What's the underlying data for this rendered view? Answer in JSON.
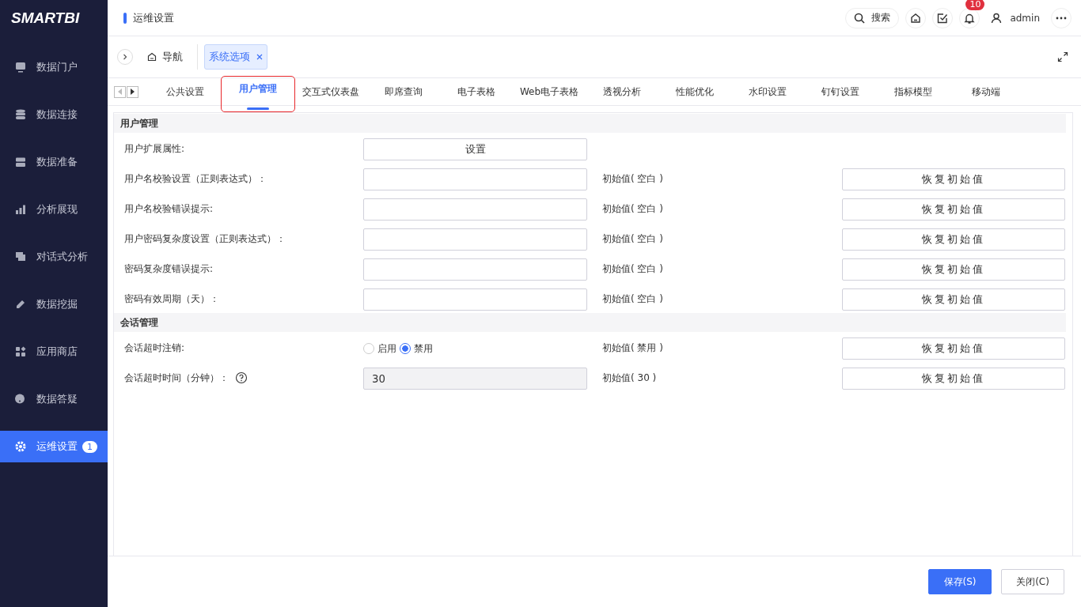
{
  "logo": "SMARTBI",
  "sidebar": {
    "items": [
      {
        "label": "数据门户",
        "selected": false
      },
      {
        "label": "数据连接",
        "selected": false
      },
      {
        "label": "数据准备",
        "selected": false
      },
      {
        "label": "分析展现",
        "selected": false
      },
      {
        "label": "对话式分析",
        "selected": false
      },
      {
        "label": "数据挖掘",
        "selected": false
      },
      {
        "label": "应用商店",
        "selected": false
      },
      {
        "label": "数据答疑",
        "selected": false
      },
      {
        "label": "运维设置",
        "selected": true,
        "badge": "1"
      }
    ]
  },
  "header": {
    "title": "运维设置",
    "search": "搜索",
    "notification_count": "10",
    "user": "admin"
  },
  "breadcrumb": {
    "home": "导航",
    "tabs": [
      {
        "label": "系统选项",
        "selected": true
      }
    ]
  },
  "tabs": [
    {
      "label": "公共设置",
      "selected": false,
      "highlighted": false
    },
    {
      "label": "用户管理",
      "selected": true,
      "highlighted": true
    },
    {
      "label": "交互式仪表盘",
      "selected": false,
      "highlighted": false
    },
    {
      "label": "即席查询",
      "selected": false,
      "highlighted": false
    },
    {
      "label": "电子表格",
      "selected": false,
      "highlighted": false
    },
    {
      "label": "Web电子表格",
      "selected": false,
      "highlighted": false
    },
    {
      "label": "透视分析",
      "selected": false,
      "highlighted": false
    },
    {
      "label": "性能优化",
      "selected": false,
      "highlighted": false
    },
    {
      "label": "水印设置",
      "selected": false,
      "highlighted": false
    },
    {
      "label": "钉钉设置",
      "selected": false,
      "highlighted": false
    },
    {
      "label": "指标模型",
      "selected": false,
      "highlighted": false
    },
    {
      "label": "移动端",
      "selected": false,
      "highlighted": false
    }
  ],
  "sections": [
    {
      "title": "用户管理",
      "rows": [
        {
          "kind": "button",
          "label": "用户扩展属性:",
          "button": "设置"
        },
        {
          "kind": "input",
          "label": "用户名校验设置（正则表达式）：",
          "initial": "初始值( 空白 )",
          "restore": "恢复初始值"
        },
        {
          "kind": "input",
          "label": "用户名校验错误提示:",
          "initial": "初始值( 空白 )",
          "restore": "恢复初始值"
        },
        {
          "kind": "input",
          "label": "用户密码复杂度设置（正则表达式）：",
          "initial": "初始值( 空白 )",
          "restore": "恢复初始值"
        },
        {
          "kind": "input",
          "label": "密码复杂度错误提示:",
          "initial": "初始值( 空白 )",
          "restore": "恢复初始值"
        },
        {
          "kind": "input",
          "label": "密码有效周期（天）：",
          "initial": "初始值( 空白 )",
          "restore": "恢复初始值"
        }
      ]
    },
    {
      "title": "会话管理",
      "rows": [
        {
          "kind": "radio",
          "label": "会话超时注销:",
          "options": [
            {
              "label": "启用",
              "selected": false
            },
            {
              "label": "禁用",
              "selected": true
            }
          ],
          "initial": "初始值( 禁用 )",
          "restore": "恢复初始值"
        },
        {
          "kind": "number",
          "label": "会话超时时间（分钟）：",
          "help": true,
          "value": "30",
          "initial": "初始值( 30 )",
          "restore": "恢复初始值"
        }
      ]
    }
  ],
  "footer": {
    "buttons": [
      {
        "label": "保存(S)",
        "primary": true
      },
      {
        "label": "关闭(C)",
        "primary": false
      }
    ]
  }
}
